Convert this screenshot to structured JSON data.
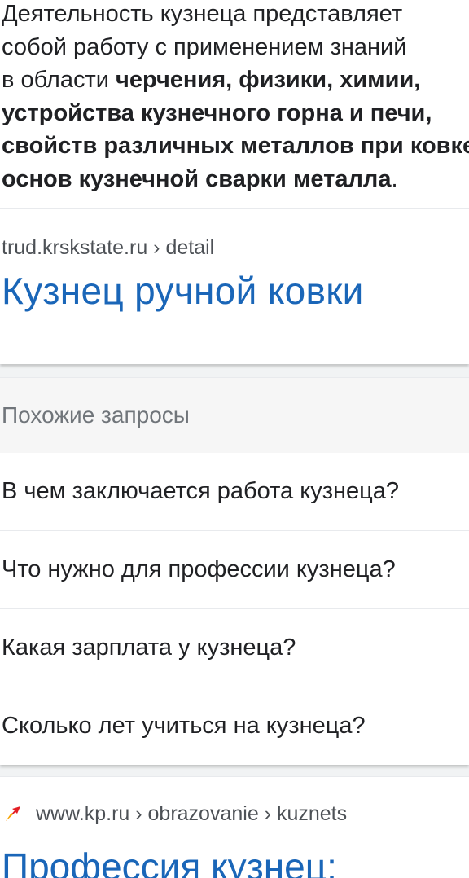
{
  "snippet": {
    "line1": "Деятельность кузнеца представляет",
    "line2": "собой работу с применением знаний",
    "line3_plain": "в области ",
    "line3_bold": "черчения, физики, химии,",
    "line4_bold": "устройства кузнечного горна и печи,",
    "line5_bold": "свойств различных металлов при ковке,",
    "line6_bold": "основ кузнечной сварки металла",
    "line6_end": "."
  },
  "result1": {
    "source": "trud.krskstate.ru › detail",
    "title": "Кузнец ручной ковки"
  },
  "related": {
    "header": "Похожие запросы",
    "items": [
      "В чем заключается работа кузнеца?",
      "Что нужно для профессии кузнеца?",
      "Какая зарплата у кузнеца?",
      "Сколько лет учиться на кузнеца?"
    ]
  },
  "result2": {
    "source": "www.kp.ru › obrazovanie › kuznets",
    "title": "Профессия кузнец:",
    "favicon": "kp-favicon-icon"
  },
  "colors": {
    "link": "#1a66b8",
    "text": "#202124",
    "secondary": "#4d5156",
    "header_bg": "#f6f6f6",
    "favicon_red": "#e31e24",
    "favicon_orange": "#f7a600"
  }
}
